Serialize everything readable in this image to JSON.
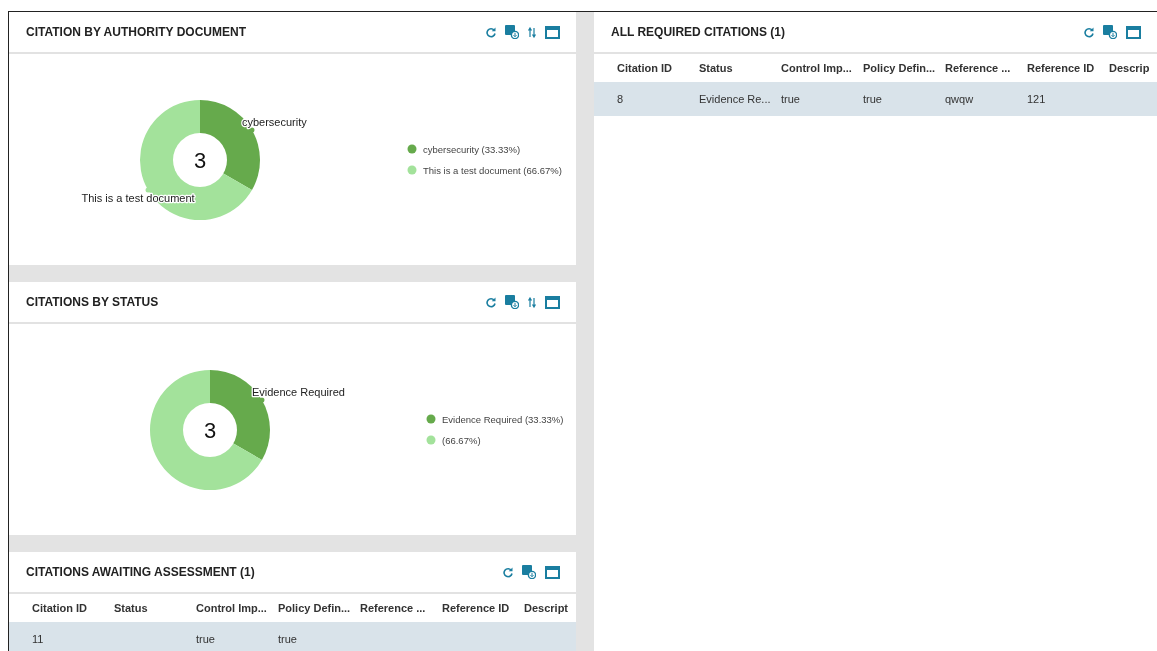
{
  "left_panels": [
    {
      "title": "CITATION BY AUTHORITY DOCUMENT",
      "sort_button": true,
      "kind": "chart",
      "center_total": "3",
      "chart_data": {
        "type": "donut",
        "categories": [
          "cybersecurity",
          "This is a test document"
        ],
        "values": [
          33.33,
          66.67
        ],
        "colors": [
          "#66aa4c",
          "#a3e29b"
        ]
      },
      "legend": [
        "cybersecurity (33.33%)",
        "This is a test document (66.67%)"
      ]
    },
    {
      "title": "CITATIONS BY STATUS",
      "sort_button": true,
      "kind": "chart",
      "center_total": "3",
      "chart_data": {
        "type": "donut",
        "categories": [
          "Evidence Required",
          null
        ],
        "values": [
          33.33,
          66.67
        ],
        "colors": [
          "#66aa4c",
          "#a3e29b"
        ]
      },
      "legend": [
        "Evidence Required (33.33%)",
        "(66.67%)"
      ]
    },
    {
      "title": "CITATIONS AWAITING ASSESSMENT (1)",
      "sort_button": false,
      "kind": "table",
      "columns": [
        "Citation ID",
        "Status",
        "Control Imp...",
        "Policy Defin...",
        "Reference ...",
        "Reference ID",
        "Descript"
      ],
      "rows": [
        {
          "cells": [
            "11",
            "",
            "true",
            "true",
            "",
            "",
            ""
          ],
          "selected": true
        }
      ]
    }
  ],
  "right_panel": {
    "title": "ALL REQUIRED CITATIONS (1)",
    "sort_button": false,
    "kind": "table",
    "columns": [
      "Citation ID",
      "Status",
      "Control Imp...",
      "Policy Defin...",
      "Reference ...",
      "Reference ID",
      "Descrip"
    ],
    "rows": [
      {
        "cells": [
          "8",
          "Evidence Re...",
          "true",
          "true",
          "qwqw",
          "121",
          ""
        ],
        "selected": true
      }
    ]
  }
}
